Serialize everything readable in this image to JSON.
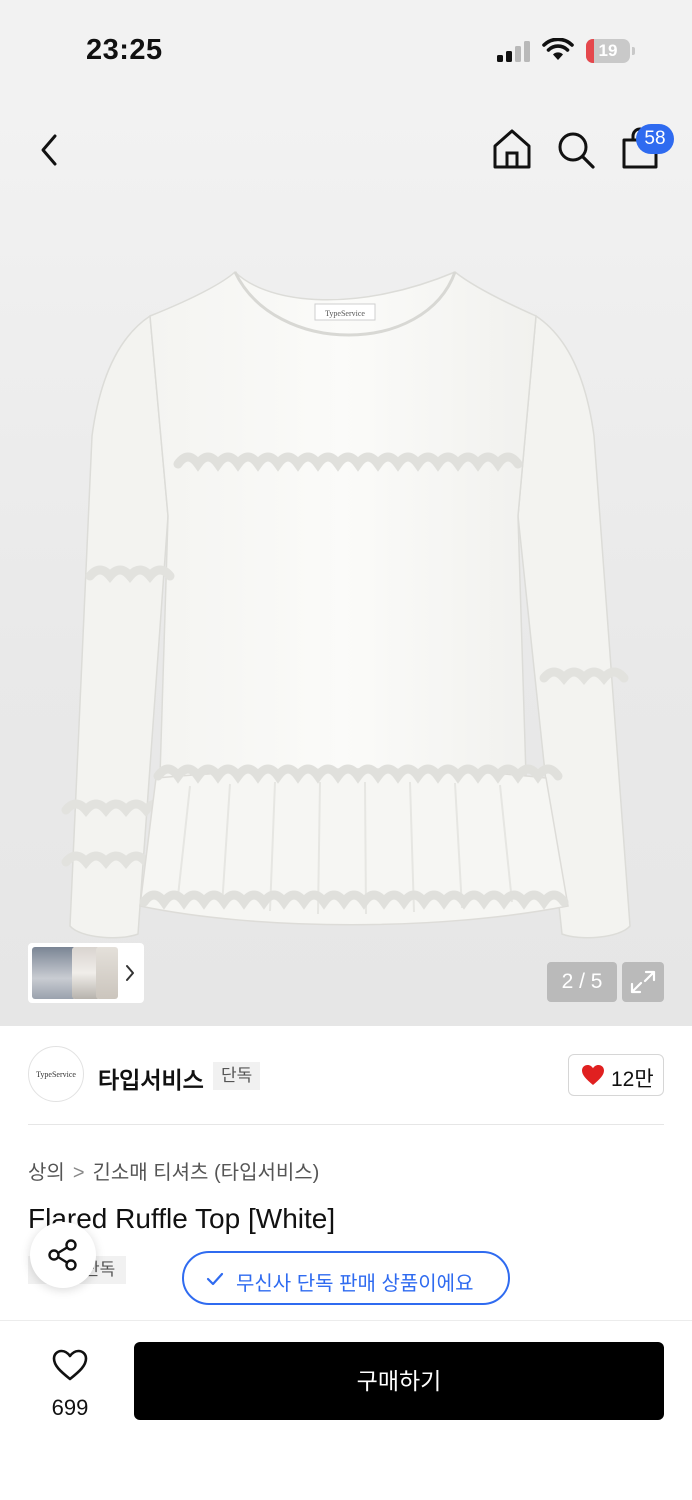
{
  "status_bar": {
    "time": "23:25",
    "battery_level": "19",
    "battery_fraction": 0.19,
    "battery_color": "#e5484d"
  },
  "nav": {
    "back_icon": "chevron-left-icon",
    "home_icon": "home-icon",
    "search_icon": "search-icon",
    "bag_icon": "shopping-bag-icon",
    "cart_count": "58",
    "accent": "#2f6bf0"
  },
  "gallery": {
    "current_page": "2 / 5",
    "logo_label": "TypeService",
    "expand_icon": "expand-icon"
  },
  "brand": {
    "logo_text": "TypeService",
    "name": "타입서비스",
    "tag": "단독",
    "likes": "12만"
  },
  "product": {
    "breadcrumb": [
      "상의",
      "긴소매 티셔츠 (타입서비스)"
    ],
    "title": "Flared Ruffle Top [White]",
    "exclusive_tag": "단독"
  },
  "toast": {
    "message": "무신사 단독 판매 상품이에요"
  },
  "bottom": {
    "wishlist_count": "699",
    "buy_label": "구매하기"
  }
}
